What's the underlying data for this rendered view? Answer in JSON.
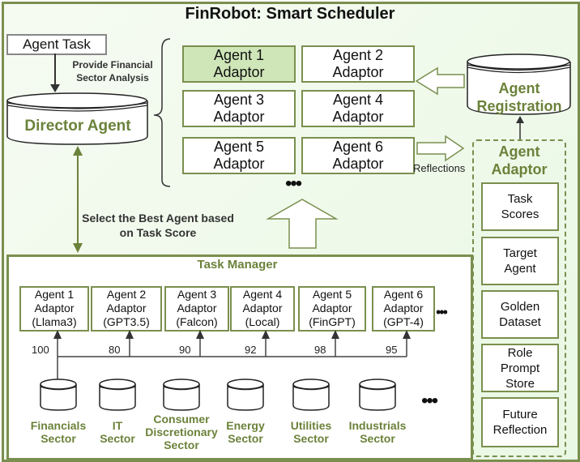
{
  "title": "FinRobot: Smart Scheduler",
  "agent_task": {
    "label": "Agent Task",
    "edge_label": "Provide Financial Sector Analysis"
  },
  "director_agent": {
    "label": "Director Agent"
  },
  "select_edge_label": "Select the Best Agent based on Task Score",
  "adaptor_pool": [
    {
      "line1": "Agent 1",
      "line2": "Adaptor",
      "highlighted": true
    },
    {
      "line1": "Agent 2",
      "line2": "Adaptor",
      "highlighted": false
    },
    {
      "line1": "Agent 3",
      "line2": "Adaptor",
      "highlighted": false
    },
    {
      "line1": "Agent 4",
      "line2": "Adaptor",
      "highlighted": false
    },
    {
      "line1": "Agent 5",
      "line2": "Adaptor",
      "highlighted": false
    },
    {
      "line1": "Agent 6",
      "line2": "Adaptor",
      "highlighted": false
    }
  ],
  "ellipsis": "•••",
  "agent_registration": {
    "line1": "Agent",
    "line2": "Registration"
  },
  "reflections_label": "Reflections",
  "agent_adaptor": {
    "title_line1": "Agent",
    "title_line2": "Adaptor",
    "items": [
      {
        "lines": [
          "Task",
          "Scores"
        ]
      },
      {
        "lines": [
          "Target",
          "Agent"
        ]
      },
      {
        "lines": [
          "Golden",
          "Dataset"
        ]
      },
      {
        "lines": [
          "Role",
          "Prompt",
          "Store"
        ]
      },
      {
        "lines": [
          "Future",
          "Reflection"
        ]
      }
    ]
  },
  "task_manager": {
    "title": "Task Manager",
    "agents": [
      {
        "line1": "Agent 1",
        "line2": "Adaptor",
        "model": "(Llama3)",
        "score": "100"
      },
      {
        "line1": "Agent 2",
        "line2": "Adaptor",
        "model": "(GPT3.5)",
        "score": "80"
      },
      {
        "line1": "Agent 3",
        "line2": "Adaptor",
        "model": "(Falcon)",
        "score": "90"
      },
      {
        "line1": "Agent 4",
        "line2": "Adaptor",
        "model": "(Local)",
        "score": "92"
      },
      {
        "line1": "Agent 5",
        "line2": "Adaptor",
        "model": "(FinGPT)",
        "score": "98"
      },
      {
        "line1": "Agent 6",
        "line2": "Adaptor",
        "model": "(GPT-4)",
        "score": "95"
      }
    ],
    "sectors": [
      {
        "lines": [
          "Financials",
          "Sector"
        ]
      },
      {
        "lines": [
          "IT",
          "Sector"
        ]
      },
      {
        "lines": [
          "Consumer",
          "Discretionary",
          "Sector"
        ]
      },
      {
        "lines": [
          "Energy",
          "Sector"
        ]
      },
      {
        "lines": [
          "Utilities",
          "Sector"
        ]
      },
      {
        "lines": [
          "Industrials",
          "Sector"
        ]
      }
    ]
  },
  "colors": {
    "accent_green": "#6b823a",
    "border_green": "#7a8f4e",
    "highlight": "#cfe6b8",
    "background": "#eef9ea"
  }
}
